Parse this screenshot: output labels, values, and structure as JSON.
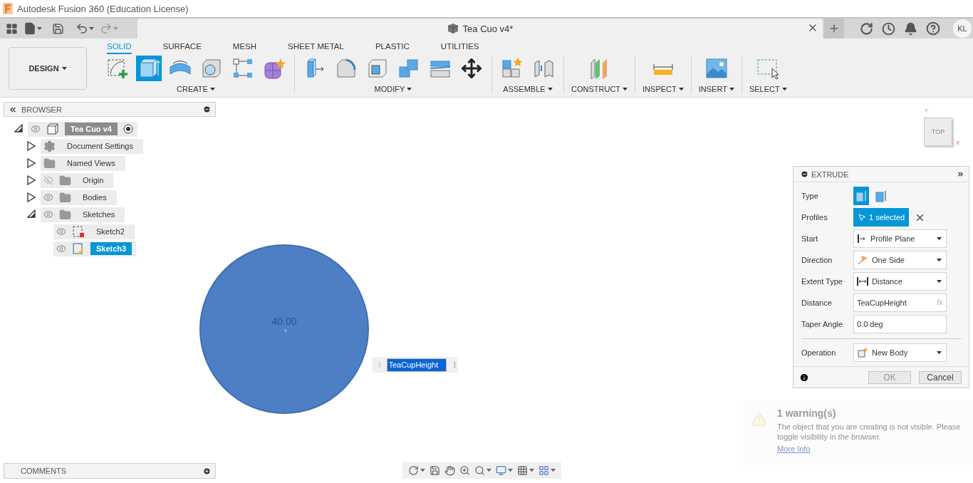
{
  "title_bar": {
    "title": "Autodesk Fusion 360 (Education License)"
  },
  "document_tab": {
    "title": "Tea Cuo v4*"
  },
  "user": {
    "initials": "KL"
  },
  "toolbar": {
    "workspace": "DESIGN",
    "tabs": [
      {
        "label": "SOLID",
        "selected": true
      },
      {
        "label": "SURFACE",
        "selected": false
      },
      {
        "label": "MESH",
        "selected": false
      },
      {
        "label": "SHEET METAL",
        "selected": false
      },
      {
        "label": "PLASTIC",
        "selected": false
      },
      {
        "label": "UTILITIES",
        "selected": false
      }
    ],
    "groups": [
      {
        "label": "CREATE",
        "tools": [
          {
            "kind": "sketch",
            "selected": false
          },
          {
            "kind": "extrude",
            "selected": true
          },
          {
            "kind": "revolve",
            "selected": false
          },
          {
            "kind": "hole",
            "selected": false
          },
          {
            "kind": "pattern",
            "selected": false
          },
          {
            "kind": "form",
            "selected": false
          }
        ]
      },
      {
        "label": "MODIFY",
        "tools": [
          {
            "kind": "press_pull",
            "selected": false
          },
          {
            "kind": "fillet",
            "selected": false
          },
          {
            "kind": "shell",
            "selected": false
          },
          {
            "kind": "combine",
            "selected": false
          },
          {
            "kind": "split",
            "selected": false
          },
          {
            "kind": "move",
            "selected": false
          }
        ]
      },
      {
        "label": "ASSEMBLE",
        "tools": [
          {
            "kind": "component",
            "selected": false
          },
          {
            "kind": "joint",
            "selected": false
          }
        ]
      },
      {
        "label": "CONSTRUCT",
        "tools": [
          {
            "kind": "plane",
            "selected": false
          }
        ]
      },
      {
        "label": "INSPECT",
        "tools": [
          {
            "kind": "measure",
            "selected": false
          }
        ]
      },
      {
        "label": "INSERT",
        "tools": [
          {
            "kind": "image",
            "selected": false
          }
        ]
      },
      {
        "label": "SELECT",
        "tools": [
          {
            "kind": "select",
            "selected": false
          }
        ]
      }
    ]
  },
  "browser": {
    "title": "BROWSER",
    "tree": [
      {
        "label": "Tea Cuo v4",
        "kind": "component",
        "expanded": true,
        "visible": true,
        "active": true,
        "selected": false,
        "children": [
          {
            "label": "Document Settings",
            "kind": "settings",
            "expanded": false,
            "selected": false
          },
          {
            "label": "Named Views",
            "kind": "folder",
            "expanded": false,
            "selected": false
          },
          {
            "label": "Origin",
            "kind": "folder",
            "expanded": false,
            "visible": false,
            "selected": false
          },
          {
            "label": "Bodies",
            "kind": "folder",
            "expanded": false,
            "visible": true,
            "selected": false
          },
          {
            "label": "Sketches",
            "kind": "folder",
            "expanded": true,
            "visible": true,
            "selected": false,
            "children": [
              {
                "label": "Sketch2",
                "kind": "sketch_locked",
                "visible": true,
                "selected": false
              },
              {
                "label": "Sketch3",
                "kind": "sketch",
                "visible": true,
                "selected": true
              }
            ]
          }
        ]
      }
    ]
  },
  "canvas": {
    "dimension": "40.00",
    "distance_input": "TeaCupHeight",
    "viewcube": {
      "face": "TOP",
      "axes": [
        "Y",
        "X"
      ]
    }
  },
  "extrude": {
    "title": "EXTRUDE",
    "rows": [
      {
        "label": "Type",
        "kind": "type",
        "options": [
          {
            "kind": "solid",
            "selected": true
          },
          {
            "kind": "thin",
            "selected": false
          }
        ]
      },
      {
        "label": "Profiles",
        "kind": "selection",
        "value": "1 selected"
      },
      {
        "label": "Start",
        "kind": "dropdown",
        "value": "Profile Plane"
      },
      {
        "label": "Direction",
        "kind": "dropdown",
        "value": "One Side"
      },
      {
        "label": "Extent Type",
        "kind": "dropdown",
        "value": "Distance"
      },
      {
        "label": "Distance",
        "kind": "expression",
        "value": "TeaCupHeight",
        "suffix": "fx"
      },
      {
        "label": "Taper Angle",
        "kind": "input",
        "value": "0.0 deg"
      }
    ],
    "operation": {
      "label": "Operation",
      "value": "New Body"
    },
    "buttons": [
      {
        "label": "OK",
        "disabled": true
      },
      {
        "label": "Cancel",
        "disabled": false
      }
    ]
  },
  "warning": {
    "title": "1 warning(s)",
    "message": "The object that you are creating is not visible. Please toggle visibility in the browser.",
    "link": "More Info"
  },
  "comments": {
    "title": "COMMENTS"
  }
}
